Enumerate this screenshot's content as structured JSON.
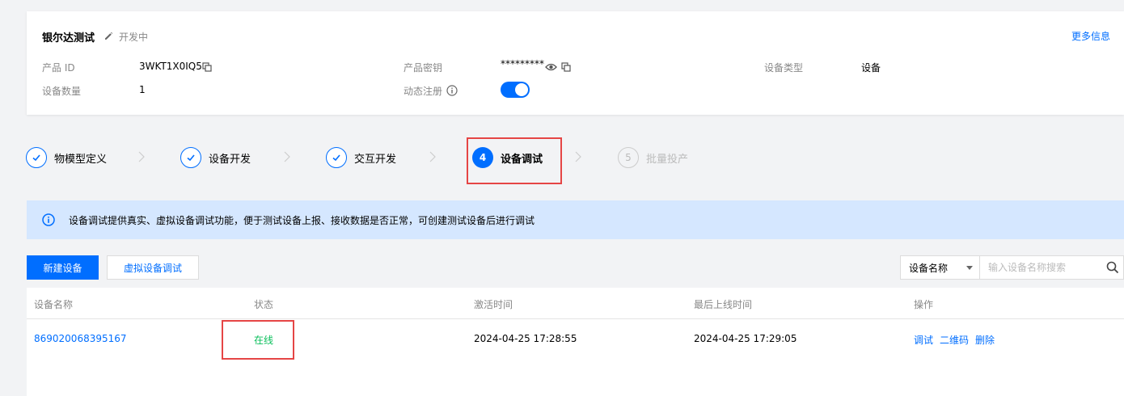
{
  "product": {
    "name": "银尔达测试",
    "status": "开发中",
    "more_info": "更多信息",
    "fields": {
      "product_id_label": "产品 ID",
      "product_id_value": "3WKT1X0IQ5",
      "device_count_label": "设备数量",
      "device_count_value": "1",
      "secret_label": "产品密钥",
      "secret_value": "*********",
      "dynamic_reg_label": "动态注册",
      "dynamic_reg_enabled": true,
      "device_type_label": "设备类型",
      "device_type_value": "设备"
    }
  },
  "steps": [
    {
      "label": "物模型定义",
      "state": "done"
    },
    {
      "label": "设备开发",
      "state": "done"
    },
    {
      "label": "交互开发",
      "state": "done"
    },
    {
      "label": "设备调试",
      "state": "active",
      "number": "4"
    },
    {
      "label": "批量投产",
      "state": "todo",
      "number": "5"
    }
  ],
  "info": {
    "text": "设备调试提供真实、虚拟设备调试功能，便于测试设备上报、接收数据是否正常，可创建测试设备后进行调试"
  },
  "toolbar": {
    "new_device": "新建设备",
    "virtual_debug": "虚拟设备调试",
    "search_field": "设备名称",
    "search_placeholder": "输入设备名称搜索"
  },
  "table": {
    "headers": {
      "name": "设备名称",
      "status": "状态",
      "activated": "激活时间",
      "last_online": "最后上线时间",
      "actions": "操作"
    },
    "rows": [
      {
        "name": "869020068395167",
        "status": "在线",
        "activated": "2024-04-25 17:28:55",
        "last_online": "2024-04-25 17:29:05",
        "actions": [
          "调试",
          "二维码",
          "删除"
        ]
      }
    ]
  },
  "colors": {
    "primary": "#006eff",
    "online": "#0abf5b",
    "highlight": "#e54545",
    "info_bg": "#d5e7ff"
  }
}
